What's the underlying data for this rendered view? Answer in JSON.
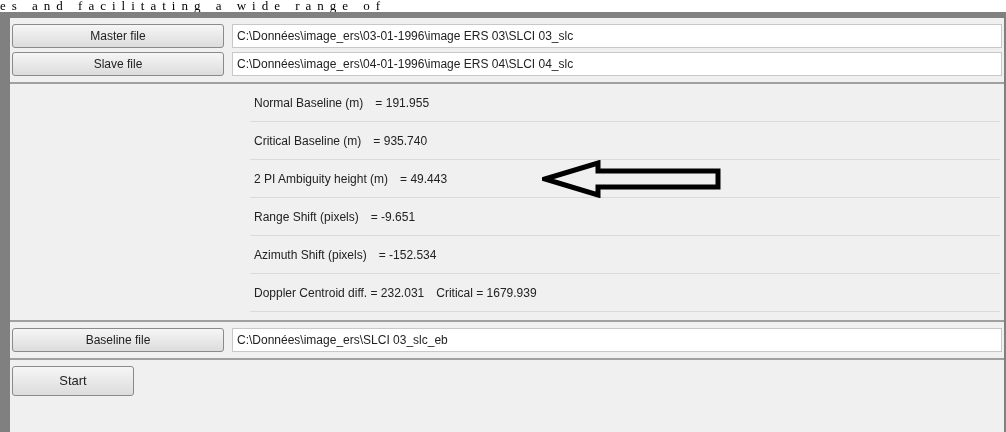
{
  "caption_fragment": "es and facilitating a wide range of",
  "file_rows": [
    {
      "button": "Master file",
      "path": "C:\\Données\\image_ers\\03-01-1996\\image ERS 03\\SLCI 03_slc"
    },
    {
      "button": "Slave file",
      "path": "C:\\Données\\image_ers\\04-01-1996\\image ERS 04\\SLCI 04_slc"
    }
  ],
  "results": [
    {
      "segments": [
        "Normal Baseline (m)",
        "= 191.955"
      ]
    },
    {
      "segments": [
        "Critical Baseline (m)",
        "= 935.740"
      ]
    },
    {
      "segments": [
        "2 PI Ambiguity height (m)",
        "= 49.443"
      ]
    },
    {
      "segments": [
        "Range Shift (pixels)",
        "= -9.651"
      ]
    },
    {
      "segments": [
        "Azimuth Shift (pixels)",
        "= -152.534"
      ]
    },
    {
      "segments": [
        "Doppler Centroid diff. = 232.031",
        "Critical = 1679.939"
      ]
    }
  ],
  "output_row": {
    "button": "Baseline file",
    "path": "C:\\Données\\image_ers\\SLCI 03_slc_eb"
  },
  "start_button": "Start"
}
